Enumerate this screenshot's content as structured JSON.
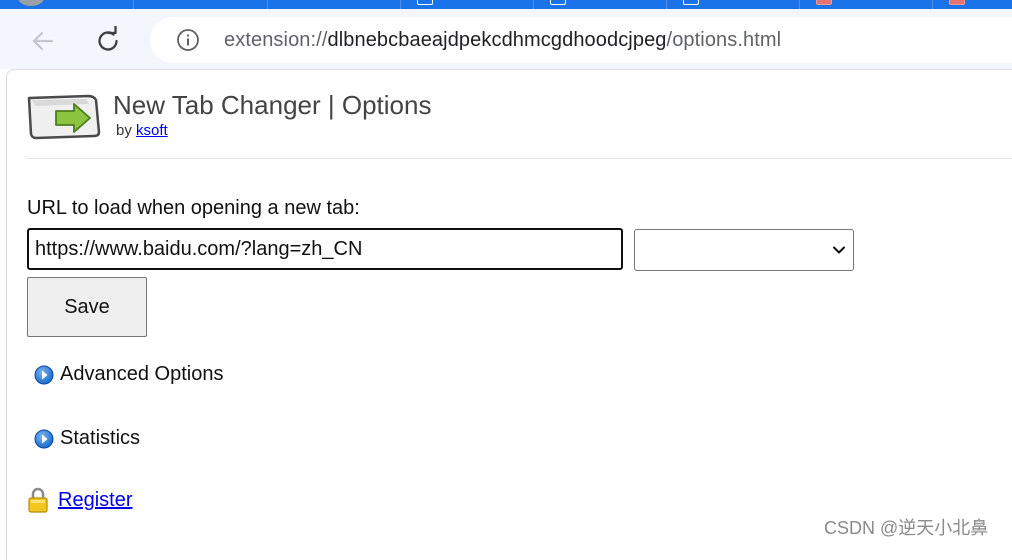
{
  "browser": {
    "address_bar": {
      "url_prefix": "extension://",
      "url_host": "dlbnebcbaeajdpekcdhmcgdhoodcjpeg",
      "url_path": "/options.html"
    }
  },
  "header": {
    "title": "New Tab Changer | Options",
    "by_prefix": "by",
    "author_link": "ksoft"
  },
  "form": {
    "url_label": "URL to load when opening a new tab:",
    "url_value": "https://www.baidu.com/?lang=zh_CN",
    "preset_selected": "",
    "save_label": "Save"
  },
  "sections": {
    "advanced_label": "Advanced Options",
    "statistics_label": "Statistics"
  },
  "register": {
    "label": "Register"
  },
  "watermark": "CSDN @逆天小北鼻",
  "colors": {
    "tabstrip": "#1a73e8",
    "toolbar": "#f3f6fc",
    "link": "#0000ee",
    "logo_arrow": "#8bc53f"
  }
}
